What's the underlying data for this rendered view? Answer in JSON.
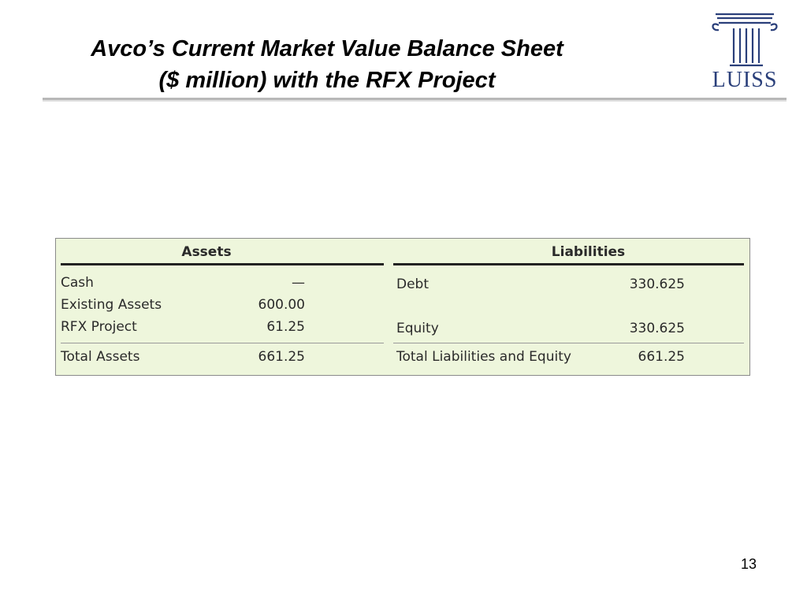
{
  "slide": {
    "title_line1": "Avco’s Current Market Value Balance Sheet",
    "title_line2": "($ million) with the RFX Project",
    "page_number": "13"
  },
  "logo": {
    "text": "LUISS",
    "color": "#2a3f7a"
  },
  "balance_sheet": {
    "background_color": "#eef6dc",
    "assets": {
      "header": "Assets",
      "rows": [
        {
          "label": "Cash",
          "value": "—"
        },
        {
          "label": "Existing Assets",
          "value": "600.00"
        },
        {
          "label": "RFX Project",
          "value": "61.25"
        }
      ],
      "total": {
        "label": "Total Assets",
        "value": "661.25"
      }
    },
    "liabilities": {
      "header": "Liabilities",
      "rows": [
        {
          "label": "Debt",
          "value": "330.625"
        },
        {
          "label": "",
          "value": ""
        },
        {
          "label": "Equity",
          "value": "330.625"
        }
      ],
      "total": {
        "label": "Total Liabilities and Equity",
        "value": "661.25"
      }
    }
  }
}
